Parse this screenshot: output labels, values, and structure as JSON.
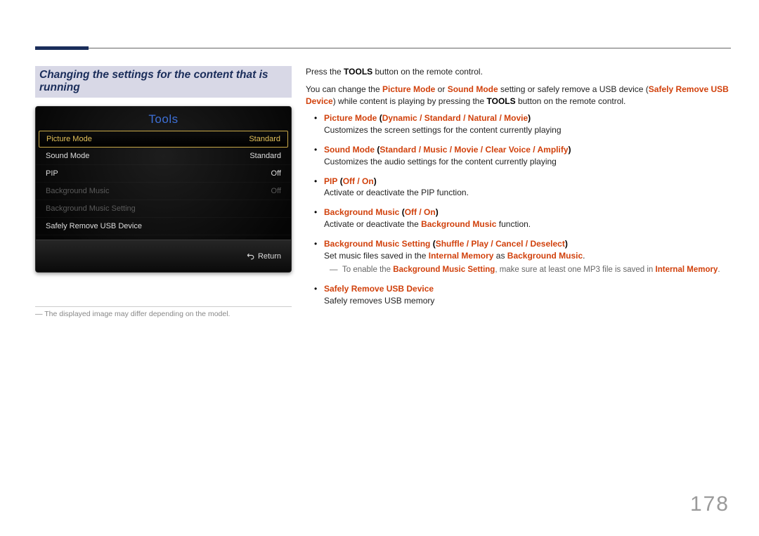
{
  "page_number": "178",
  "section_title": "Changing the settings for the content that is running",
  "tv_panel": {
    "title": "Tools",
    "rows": [
      {
        "label": "Picture Mode",
        "value": "Standard",
        "state": "selected"
      },
      {
        "label": "Sound Mode",
        "value": "Standard",
        "state": "normal"
      },
      {
        "label": "PIP",
        "value": "Off",
        "state": "normal"
      },
      {
        "label": "Background Music",
        "value": "Off",
        "state": "dim"
      },
      {
        "label": "Background Music Setting",
        "value": "",
        "state": "dim"
      },
      {
        "label": "Safely Remove USB Device",
        "value": "",
        "state": "normal"
      }
    ],
    "footer_return": "Return"
  },
  "caption_note": "The displayed image may differ depending on the model.",
  "intro": {
    "line1_pre": "Press the ",
    "line1_bold": "TOOLS",
    "line1_post": " button on the remote control.",
    "line2_a": "You can change the ",
    "line2_pm": "Picture Mode",
    "line2_or": " or ",
    "line2_sm": "Sound Mode",
    "line2_mid": " setting or safely remove a USB device (",
    "line2_safe": "Safely Remove USB Device",
    "line2_tail": ") while content is playing by pressing the ",
    "line2_tools": "TOOLS",
    "line2_end": " button on the remote control."
  },
  "items": {
    "picture_mode": {
      "title": "Picture Mode",
      "opts": [
        "Dynamic",
        "Standard",
        "Natural",
        "Movie"
      ],
      "desc": "Customizes the screen settings for the content currently playing"
    },
    "sound_mode": {
      "title": "Sound Mode",
      "opts": [
        "Standard",
        "Music",
        "Movie",
        "Clear Voice",
        "Amplify"
      ],
      "desc": "Customizes the audio settings for the content currently playing"
    },
    "pip": {
      "title": "PIP",
      "opts": [
        "Off",
        "On"
      ],
      "desc": "Activate or deactivate the PIP function."
    },
    "bg_music": {
      "title": "Background Music",
      "opts": [
        "Off",
        "On"
      ],
      "desc_a": "Activate or deactivate the ",
      "desc_bold": "Background Music",
      "desc_b": " function."
    },
    "bg_setting": {
      "title": "Background Music Setting",
      "opts": [
        "Shuffle",
        "Play",
        "Cancel",
        "Deselect"
      ],
      "desc_a": "Set music files saved in the ",
      "desc_mem": "Internal Memory",
      "desc_mid": " as ",
      "desc_bg": "Background Music",
      "desc_end": ".",
      "note_a": "To enable the ",
      "note_bold1": "Background Music Setting",
      "note_mid": ", make sure at least one MP3 file is saved in ",
      "note_bold2": "Internal Memory",
      "note_end": "."
    },
    "safe_remove": {
      "title": "Safely Remove USB Device",
      "desc": "Safely removes USB memory"
    }
  }
}
